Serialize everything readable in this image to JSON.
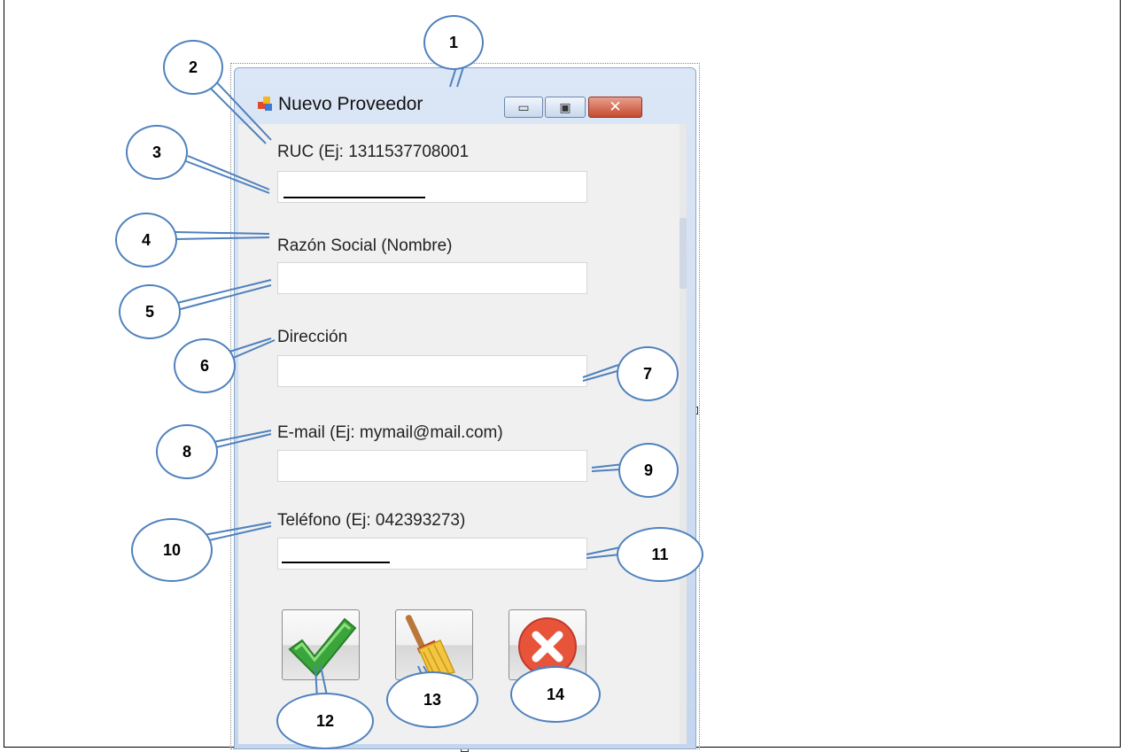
{
  "window": {
    "title": "Nuevo Proveedor",
    "minimize_glyph": "▭",
    "maximize_glyph": "▣",
    "close_glyph": "✕"
  },
  "form": {
    "ruc_label": "RUC (Ej: 1311537708001",
    "razon_label": "Razón Social (Nombre)",
    "direccion_label": "Dirección",
    "email_label": "E-mail (Ej: mymail@mail.com)",
    "telefono_label": "Teléfono (Ej: 042393273)"
  },
  "buttons": {
    "accept_icon": "check-icon",
    "clear_icon": "broom-icon",
    "cancel_icon": "cancel-icon"
  },
  "callouts": [
    "1",
    "2",
    "3",
    "4",
    "5",
    "6",
    "7",
    "8",
    "9",
    "10",
    "11",
    "12",
    "13",
    "14"
  ],
  "colors": {
    "callout_border": "#4f81bd",
    "accept_green": "#3aa53a",
    "cancel_red": "#e8543a"
  }
}
